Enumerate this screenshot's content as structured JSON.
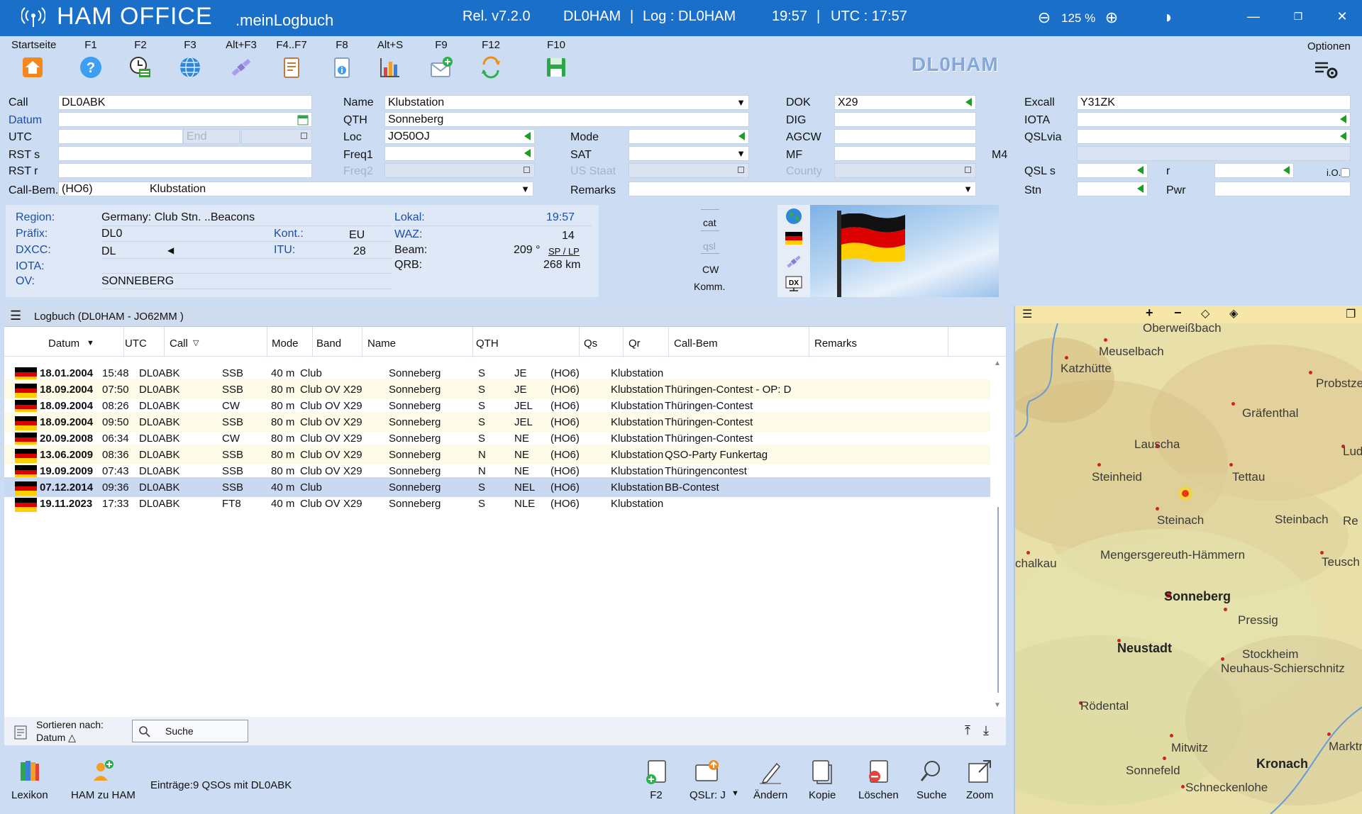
{
  "titlebar": {
    "app_name": "HAM OFFICE",
    "app_sub": ".meinLogbuch",
    "release": "Rel. v7.2.0",
    "station": "DL0HAM",
    "sep1": "|",
    "log_label": "Log : DL0HAM",
    "time_local": "19:57",
    "sep2": "|",
    "time_utc": "UTC : 17:57",
    "zoom": "125 %"
  },
  "toolbar": {
    "items": [
      {
        "key": "Startseite",
        "icon": "home-icon"
      },
      {
        "key": "F1",
        "icon": "help-icon"
      },
      {
        "key": "F2",
        "icon": "add-qso-clock-icon"
      },
      {
        "key": "F3",
        "icon": "globe-icon"
      },
      {
        "key": "Alt+F3",
        "icon": "satellite-icon"
      },
      {
        "key": "F4..F7",
        "icon": "document-icon"
      },
      {
        "key": "F8",
        "icon": "info-icon"
      },
      {
        "key": "Alt+S",
        "icon": "statistics-icon"
      },
      {
        "key": "F9",
        "icon": "mail-icon"
      },
      {
        "key": "F12",
        "icon": "sync-icon"
      },
      {
        "key": "F10",
        "icon": "save-icon"
      }
    ],
    "callsign_logo": "DL0HAM",
    "options_label": "Optionen"
  },
  "form": {
    "call_label": "Call",
    "call_value": "DL0ABK",
    "datum_label": "Datum",
    "datum_value": "",
    "utc_label": "UTC",
    "utc_value": "",
    "end_label": "End",
    "rsts_label": "RST s",
    "rstr_label": "RST r",
    "callbem_label": "Call-Bem.",
    "callbem_code": "(HO6)",
    "callbem_value": "Klubstation",
    "name_label": "Name",
    "name_value": "Klubstation",
    "qth_label": "QTH",
    "qth_value": "Sonneberg",
    "loc_label": "Loc",
    "loc_value": "JO50OJ",
    "freq1_label": "Freq1",
    "freq2_label": "Freq2",
    "mode_label": "Mode",
    "sat_label": "SAT",
    "usstaat_label": "US Staat",
    "remarks_label": "Remarks",
    "dok_label": "DOK",
    "dok_value": "X29",
    "dig_label": "DIG",
    "agcw_label": "AGCW",
    "mf_label": "MF",
    "county_label": "County",
    "m4_label": "M4",
    "excall_label": "Excall",
    "excall_value": "Y31ZK",
    "iota_label": "IOTA",
    "qslvia_label": "QSLvia",
    "qsls_label": "QSL s",
    "r_label": "r",
    "io_label": "i.O.",
    "stn_label": "Stn",
    "pwr_label": "Pwr"
  },
  "info": {
    "region_label": "Region:",
    "region_value": "Germany: Club Stn. ..Beacons",
    "prefix_label": "Präfix:",
    "prefix_value": "DL0",
    "kont_label": "Kont.:",
    "kont_value": "EU",
    "dxcc_label": "DXCC:",
    "dxcc_value": "DL",
    "itu_label": "ITU:",
    "itu_value": "28",
    "iota_label": "IOTA:",
    "ov_label": "OV:",
    "ov_value": "SONNEBERG",
    "lokal_label": "Lokal:",
    "lokal_value": "19:57",
    "waz_label": "WAZ:",
    "waz_value": "14",
    "beam_label": "Beam:",
    "beam_value": "209 °",
    "beam_link": "SP / LP",
    "qrb_label": "QRB:",
    "qrb_value": "268  km",
    "cat_label": "cat",
    "qsl_label": "qsl",
    "cw_label": "CW",
    "komm_label": "Komm."
  },
  "logbook": {
    "title": "Logbuch  (DL0HAM - JO62MM )",
    "columns": [
      "Datum",
      "UTC",
      "Call",
      "Mode",
      "Band",
      "Name",
      "QTH",
      "Qs",
      "Qr",
      "Call-Bem",
      "Remarks"
    ],
    "rows": [
      {
        "datum": "18.01.2004",
        "utc": "15:48",
        "call": "DL0ABK",
        "mode": "SSB",
        "band": "40 m",
        "name": "Club",
        "qth": "Sonneberg",
        "qs": "S",
        "qr": "JE",
        "cb_code": "(HO6)",
        "cb": "Klubstation",
        "remarks": ""
      },
      {
        "datum": "18.09.2004",
        "utc": "07:50",
        "call": "DL0ABK",
        "mode": "SSB",
        "band": "80 m",
        "name": "Club OV X29",
        "qth": "Sonneberg",
        "qs": "S",
        "qr": "JE",
        "cb_code": "(HO6)",
        "cb": "Klubstation",
        "remarks": "Thüringen-Contest  -  OP: D"
      },
      {
        "datum": "18.09.2004",
        "utc": "08:26",
        "call": "DL0ABK",
        "mode": "CW",
        "band": "80 m",
        "name": "Club OV X29",
        "qth": "Sonneberg",
        "qs": "S",
        "qr": "JEL",
        "cb_code": "(HO6)",
        "cb": "Klubstation",
        "remarks": "Thüringen-Contest"
      },
      {
        "datum": "18.09.2004",
        "utc": "09:50",
        "call": "DL0ABK",
        "mode": "SSB",
        "band": "80 m",
        "name": "Club OV X29",
        "qth": "Sonneberg",
        "qs": "S",
        "qr": "JEL",
        "cb_code": "(HO6)",
        "cb": "Klubstation",
        "remarks": "Thüringen-Contest"
      },
      {
        "datum": "20.09.2008",
        "utc": "06:34",
        "call": "DL0ABK",
        "mode": "CW",
        "band": "80 m",
        "name": "Club OV X29",
        "qth": "Sonneberg",
        "qs": "S",
        "qr": "NE",
        "cb_code": "(HO6)",
        "cb": "Klubstation",
        "remarks": "Thüringen-Contest"
      },
      {
        "datum": "13.06.2009",
        "utc": "08:36",
        "call": "DL0ABK",
        "mode": "SSB",
        "band": "80 m",
        "name": "Club OV X29",
        "qth": "Sonneberg",
        "qs": "N",
        "qr": "NE",
        "cb_code": "(HO6)",
        "cb": "Klubstation",
        "remarks": "QSO-Party Funkertag"
      },
      {
        "datum": "19.09.2009",
        "utc": "07:43",
        "call": "DL0ABK",
        "mode": "SSB",
        "band": "80 m",
        "name": "Club OV X29",
        "qth": "Sonneberg",
        "qs": "N",
        "qr": "NE",
        "cb_code": "(HO6)",
        "cb": "Klubstation",
        "remarks": "Thüringencontest"
      },
      {
        "datum": "07.12.2014",
        "utc": "09:36",
        "call": "DL0ABK",
        "mode": "SSB",
        "band": "40 m",
        "name": "Club",
        "qth": "Sonneberg",
        "qs": "S",
        "qr": "NEL",
        "cb_code": "(HO6)",
        "cb": "Klubstation",
        "remarks": "BB-Contest"
      },
      {
        "datum": "19.11.2023",
        "utc": "17:33",
        "call": "DL0ABK",
        "mode": "FT8",
        "band": "40 m",
        "name": "Club OV X29",
        "qth": "Sonneberg",
        "qs": "S",
        "qr": "NLE",
        "cb_code": "(HO6)",
        "cb": "Klubstation",
        "remarks": ""
      }
    ],
    "selected_row": 8,
    "sort_label": "Sortieren nach:",
    "sort_value": "Datum △",
    "search_placeholder": "Suche"
  },
  "actions": {
    "lexikon": "Lexikon",
    "ham_zu_ham": "HAM zu HAM",
    "entries": "Einträge:9 QSOs mit DL0ABK",
    "f2": "F2",
    "qslr": "QSLr: J",
    "aendern": "Ändern",
    "kopie": "Kopie",
    "loeschen": "Löschen",
    "suche": "Suche",
    "zoom": "Zoom"
  },
  "map": {
    "toolbar": [
      "+",
      "−",
      "◇",
      "◈"
    ],
    "towns": [
      {
        "name": "Oberweißbach",
        "bold": false
      },
      {
        "name": "Meuselbach",
        "bold": false
      },
      {
        "name": "Katzhütte",
        "bold": false
      },
      {
        "name": "Probstze",
        "bold": false
      },
      {
        "name": "Gräfenthal",
        "bold": false
      },
      {
        "name": "Lauscha",
        "bold": false
      },
      {
        "name": "Ludwig",
        "bold": false
      },
      {
        "name": "Steinheid",
        "bold": false
      },
      {
        "name": "Tettau",
        "bold": false
      },
      {
        "name": "Steinach",
        "bold": false
      },
      {
        "name": "Steinbach",
        "bold": false
      },
      {
        "name": "Re",
        "bold": false
      },
      {
        "name": "chalkau",
        "bold": false
      },
      {
        "name": "Mengersgereuth-Hämmern",
        "bold": false
      },
      {
        "name": "Teusch",
        "bold": false
      },
      {
        "name": "Sonneberg",
        "bold": true
      },
      {
        "name": "Pressig",
        "bold": false
      },
      {
        "name": "Neustadt",
        "bold": true
      },
      {
        "name": "Stockheim",
        "bold": false
      },
      {
        "name": "Neuhaus-Schierschnitz",
        "bold": false
      },
      {
        "name": "Rödental",
        "bold": false
      },
      {
        "name": "Mitwitz",
        "bold": false
      },
      {
        "name": "Marktr",
        "bold": false
      },
      {
        "name": "Kronach",
        "bold": true
      },
      {
        "name": "Sonnefeld",
        "bold": false
      },
      {
        "name": "Schneckenlohe",
        "bold": false
      }
    ]
  },
  "colors": {
    "titlebar": "#1a6fc9",
    "toolbar_bg": "#cbdcf3",
    "selected_row": "#c9d9f1",
    "alt_row": "#fdfbe8",
    "flag_black": "#000000",
    "flag_red": "#dd0000",
    "flag_gold": "#ffce00"
  }
}
